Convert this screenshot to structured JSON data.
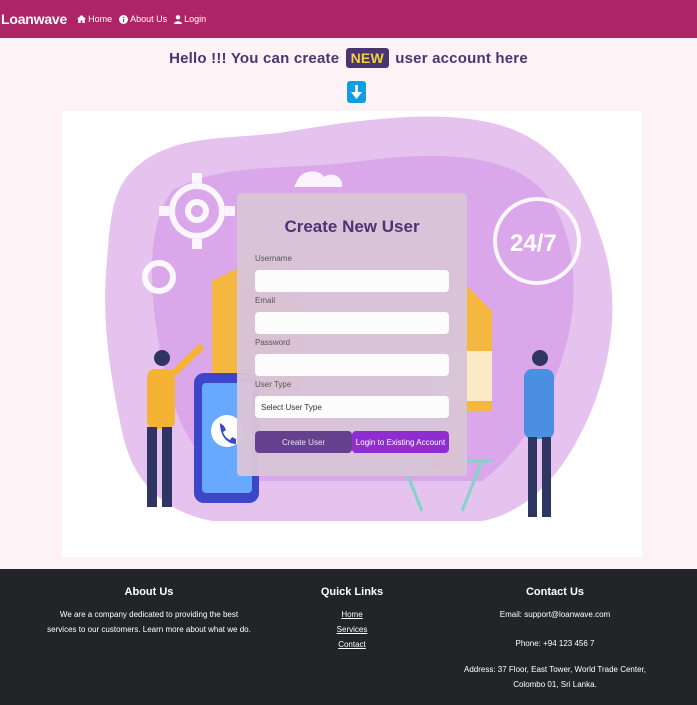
{
  "navbar": {
    "brand": "Loanwave",
    "links": [
      {
        "label": "Home",
        "icon": "home-icon"
      },
      {
        "label": "About Us",
        "icon": "info-icon"
      },
      {
        "label": "Login",
        "icon": "user-icon"
      }
    ]
  },
  "headline": {
    "before": "Hello !!! You can create",
    "badge": "NEW",
    "after": "user account here"
  },
  "form": {
    "title": "Create New User",
    "username_label": "Username",
    "email_label": "Email",
    "password_label": "Password",
    "usertype_label": "User Type",
    "usertype_selected": "Select User Type",
    "create_button": "Create User",
    "login_button": "Login to Existing Account"
  },
  "hero": {
    "badge_text": "24/7"
  },
  "footer": {
    "about": {
      "title": "About Us",
      "line1": "We are a company dedicated to providing the best",
      "line2": "services to our customers. Learn more about what we do."
    },
    "links": {
      "title": "Quick Links",
      "items": [
        "Home",
        "Services",
        "Contact"
      ]
    },
    "contact": {
      "title": "Contact Us",
      "email": "Email: support@loanwave.com",
      "phone": "Phone: +94 123 456 7",
      "address1": "Address: 37 Floor, East Tower, World Trade Center,",
      "address2": "Colombo 01, Sri Lanka."
    }
  },
  "colors": {
    "navbar": "#ad2566",
    "accent": "#4b3472",
    "badge_text": "#f3d03b",
    "create_button": "#65408e",
    "login_button": "#8e2ed1",
    "footer": "#222427"
  }
}
